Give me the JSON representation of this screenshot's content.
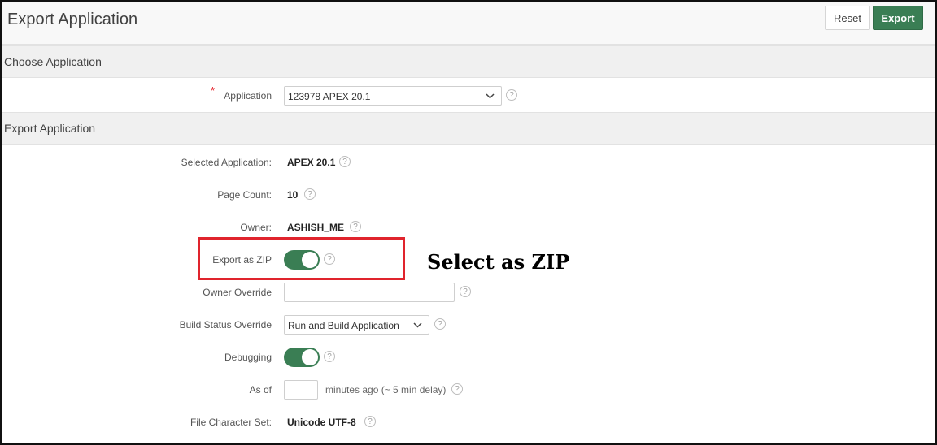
{
  "header": {
    "title": "Export Application",
    "reset_label": "Reset",
    "export_label": "Export"
  },
  "sections": {
    "choose": "Choose Application",
    "export": "Export Application"
  },
  "choose_application": {
    "required_marker": "*",
    "label": "Application",
    "selected_value": "123978 APEX 20.1"
  },
  "fields": {
    "selected_application": {
      "label": "Selected Application:",
      "value": "APEX 20.1"
    },
    "page_count": {
      "label": "Page Count:",
      "value": "10"
    },
    "owner": {
      "label": "Owner:",
      "value": "ASHISH_ME"
    },
    "export_as_zip": {
      "label": "Export as ZIP",
      "state": "on"
    },
    "owner_override": {
      "label": "Owner Override",
      "value": ""
    },
    "build_status_override": {
      "label": "Build Status Override",
      "selected_value": "Run and Build Application"
    },
    "debugging": {
      "label": "Debugging",
      "state": "on"
    },
    "as_of": {
      "label": "As of",
      "value": "",
      "suffix": "minutes ago (~ 5 min delay)"
    },
    "file_character_set": {
      "label": "File Character Set:",
      "value": "Unicode UTF-8"
    }
  },
  "help_glyph": "?",
  "annotation": {
    "text": "Select as ZIP",
    "highlight_color": "#e0242d"
  },
  "colors": {
    "accent_green": "#3a7e54"
  }
}
